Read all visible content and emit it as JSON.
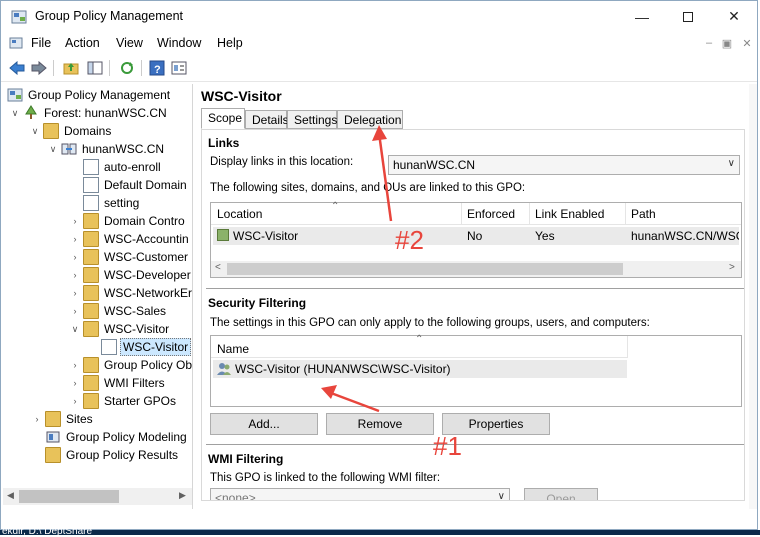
{
  "window": {
    "title": "Group Policy Management"
  },
  "menu": [
    "File",
    "Action",
    "View",
    "Window",
    "Help"
  ],
  "tree": {
    "root": "Group Policy Management",
    "forest": "Forest: hunanWSC.CN",
    "domains": "Domains",
    "domain": "hunanWSC.CN",
    "items": [
      "auto-enroll",
      "Default Domain",
      "setting",
      "Domain Contro",
      "WSC-Accountin",
      "WSC-Customer",
      "WSC-Developer",
      "WSC-NetworkEr",
      "WSC-Sales",
      "WSC-Visitor",
      "WSC-Visitor",
      "Group Policy Ob",
      "WMI Filters",
      "Starter GPOs"
    ],
    "sites": "Sites",
    "modeling": "Group Policy Modeling",
    "results": "Group Policy Results"
  },
  "pane": {
    "title": "WSC-Visitor",
    "tabs": [
      "Scope",
      "Details",
      "Settings",
      "Delegation"
    ],
    "links": {
      "heading": "Links",
      "display_label": "Display links in this location:",
      "location_value": "hunanWSC.CN",
      "desc": "The following sites, domains, and OUs are linked to this GPO:",
      "columns": [
        "Location",
        "Enforced",
        "Link Enabled",
        "Path"
      ],
      "rows": [
        {
          "location": "WSC-Visitor",
          "enforced": "No",
          "link_enabled": "Yes",
          "path": "hunanWSC.CN/WSC-V"
        }
      ]
    },
    "security": {
      "heading": "Security Filtering",
      "desc": "The settings in this GPO can only apply to the following groups, users, and computers:",
      "column": "Name",
      "rows": [
        "WSC-Visitor (HUNANWSC\\WSC-Visitor)"
      ],
      "buttons": {
        "add": "Add...",
        "remove": "Remove",
        "properties": "Properties"
      }
    },
    "wmi": {
      "heading": "WMI Filtering",
      "desc": "This GPO is linked to the following WMI filter:",
      "value": "<none>",
      "open": "Open"
    }
  },
  "annotations": {
    "one": "#1",
    "two": "#2"
  },
  "taskbar_text": "ekdir, D:\\ DeptShare"
}
